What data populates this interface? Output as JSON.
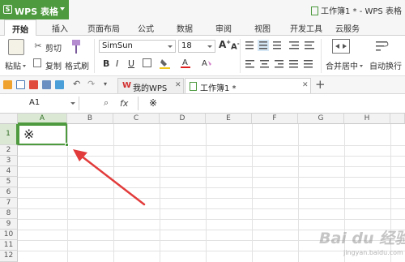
{
  "app": {
    "name": "WPS 表格",
    "logo_letter": "S"
  },
  "window": {
    "title": "工作簿1 * - WPS 表格"
  },
  "menu": {
    "tabs": [
      "开始",
      "插入",
      "页面布局",
      "公式",
      "数据",
      "审阅",
      "视图",
      "开发工具",
      "云服务"
    ],
    "active": "开始"
  },
  "ribbon": {
    "paste": "粘贴",
    "cut": "剪切",
    "copy": "复制",
    "format_painter": "格式刷",
    "font_name": "SimSun",
    "font_size": "18",
    "merge_center": "合并居中",
    "wrap_text": "自动换行",
    "bold": "B",
    "italic": "I",
    "underline": "U",
    "grow_font": "A",
    "shrink_font": "A"
  },
  "doc_tabs": [
    {
      "label": "我的WPS",
      "active": false
    },
    {
      "label": "工作簿1 *",
      "active": true
    }
  ],
  "new_tab": "+",
  "formula_bar": {
    "cell_ref": "A1",
    "fx": "fx",
    "content": "※"
  },
  "sheet": {
    "columns": [
      "A",
      "B",
      "C",
      "D",
      "E",
      "F",
      "G",
      "H"
    ],
    "rows": [
      "1",
      "2",
      "3",
      "4",
      "5",
      "6",
      "7",
      "8",
      "9",
      "10",
      "11",
      "12"
    ],
    "selected_cell": "A1",
    "a1_value": "※"
  },
  "watermark": {
    "text": "Bai du 经验",
    "sub": "jingyan.baidu.com"
  },
  "colors": {
    "accent": "#4e9a3f",
    "arrow": "#e23b3b"
  },
  "icons": [
    "scissors-icon",
    "copy-icon",
    "brush-icon",
    "save-icon",
    "undo-icon",
    "redo-icon",
    "search-icon"
  ]
}
